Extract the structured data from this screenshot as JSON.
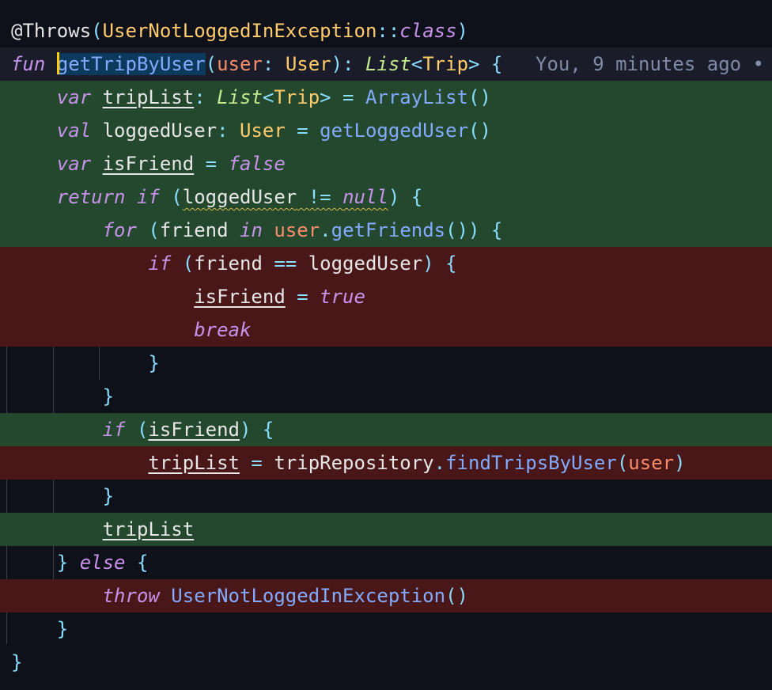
{
  "code": {
    "annotation": "@Throws",
    "exception_class": "UserNotLoggedInException",
    "class_ref": "::class",
    "fun_kw": "fun",
    "fun_name": "getTripByUser",
    "param_name": "user",
    "param_type": "User",
    "list_type": "List",
    "trip_type": "Trip",
    "var_kw": "var",
    "val_kw": "val",
    "trip_list": "tripList",
    "array_list": "ArrayList",
    "logged_user": "loggedUser",
    "get_logged_user": "getLoggedUser",
    "is_friend": "isFriend",
    "false_kw": "false",
    "true_kw": "true",
    "return_kw": "return",
    "if_kw": "if",
    "null_kw": "null",
    "for_kw": "for",
    "friend": "friend",
    "in_kw": "in",
    "get_friends": "getFriends",
    "break_kw": "break",
    "trip_repository": "tripRepository",
    "find_trips": "findTripsByUser",
    "else_kw": "else",
    "throw_kw": "throw"
  },
  "blame": "You, 9 minutes ago •"
}
